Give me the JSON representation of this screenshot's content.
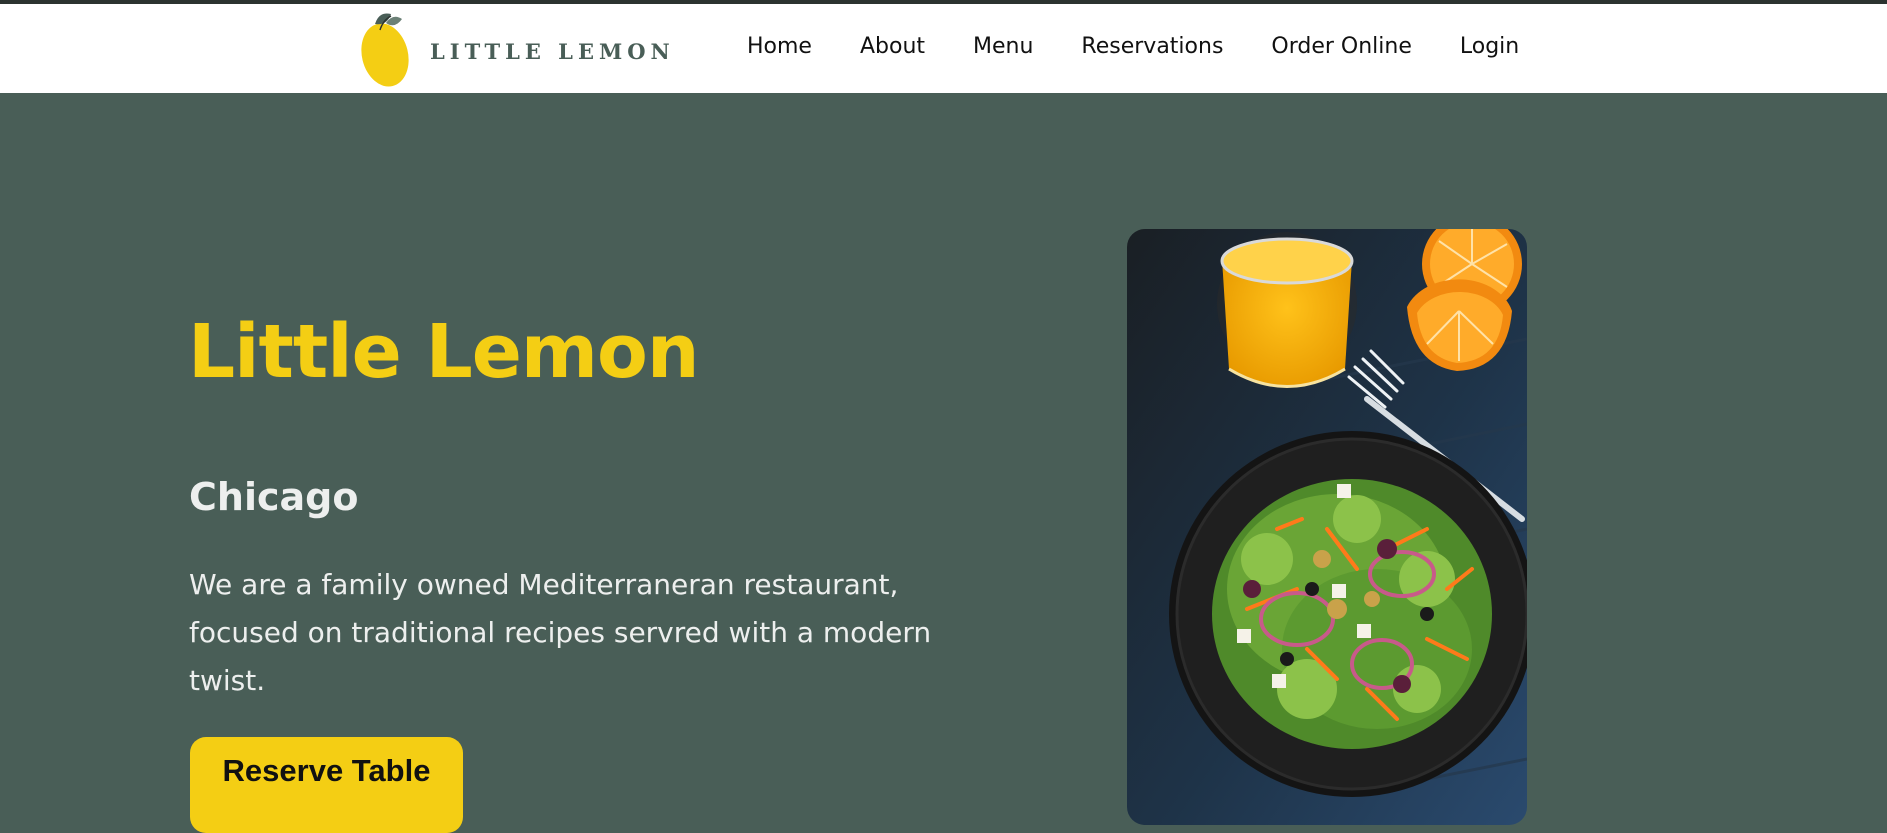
{
  "header": {
    "logo_text": "LITTLE LEMON",
    "nav": [
      {
        "label": "Home"
      },
      {
        "label": "About"
      },
      {
        "label": "Menu"
      },
      {
        "label": "Reservations"
      },
      {
        "label": "Order Online"
      },
      {
        "label": "Login"
      }
    ]
  },
  "hero": {
    "title": "Little Lemon",
    "subtitle": "Chicago",
    "description": "We are a family owned Mediterraneran restaurant, focused on traditional recipes servred with a modern twist.",
    "cta_label": "Reserve Table"
  },
  "colors": {
    "primary_green": "#495e57",
    "primary_yellow": "#f4ce14",
    "light_text": "#edefee"
  },
  "icons": [
    "lemon-logo-icon"
  ]
}
